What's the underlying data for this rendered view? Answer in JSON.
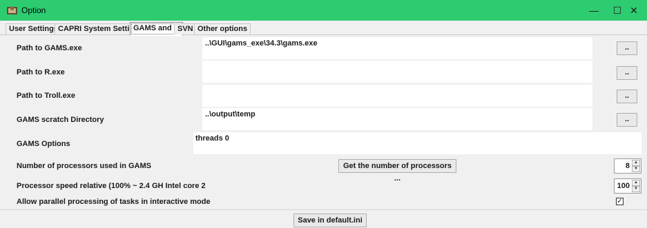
{
  "window": {
    "title": "Option",
    "minimize": "—",
    "maximize": "☐",
    "close": "✕"
  },
  "tabs": [
    {
      "label": "User Settings"
    },
    {
      "label": "CAPRI System Settings"
    },
    {
      "label": "GAMS and R"
    },
    {
      "label": "SVN"
    },
    {
      "label": "Other options"
    }
  ],
  "paths": {
    "gams_label": "Path to GAMS.exe",
    "gams_value": "..\\GUI\\gams_exe\\34.3\\gams.exe",
    "r_label": "Path to R.exe",
    "r_value": "",
    "troll_label": "Path to Troll.exe",
    "troll_value": "",
    "scratch_label": "GAMS scratch Directory",
    "scratch_value": "..\\output\\temp",
    "options_label": "GAMS Options",
    "options_value": "threads 0",
    "browse_label": ".."
  },
  "processors": {
    "label": "Number of processors used in GAMS",
    "button_label": "Get the number of processors ...",
    "value": "8"
  },
  "speed": {
    "label": "Processor speed relative (100% ~ 2.4 GH Intel core 2",
    "value": "100"
  },
  "parallel": {
    "label": "Allow parallel processing of tasks in interactive mode",
    "checked": true,
    "check_mark": "✓"
  },
  "footer": {
    "save_label": "Save in default.ini"
  },
  "colors": {
    "titlebar": "#2ecc71",
    "field_bg": "#ffffff",
    "window_bg": "#f0f0f0"
  }
}
